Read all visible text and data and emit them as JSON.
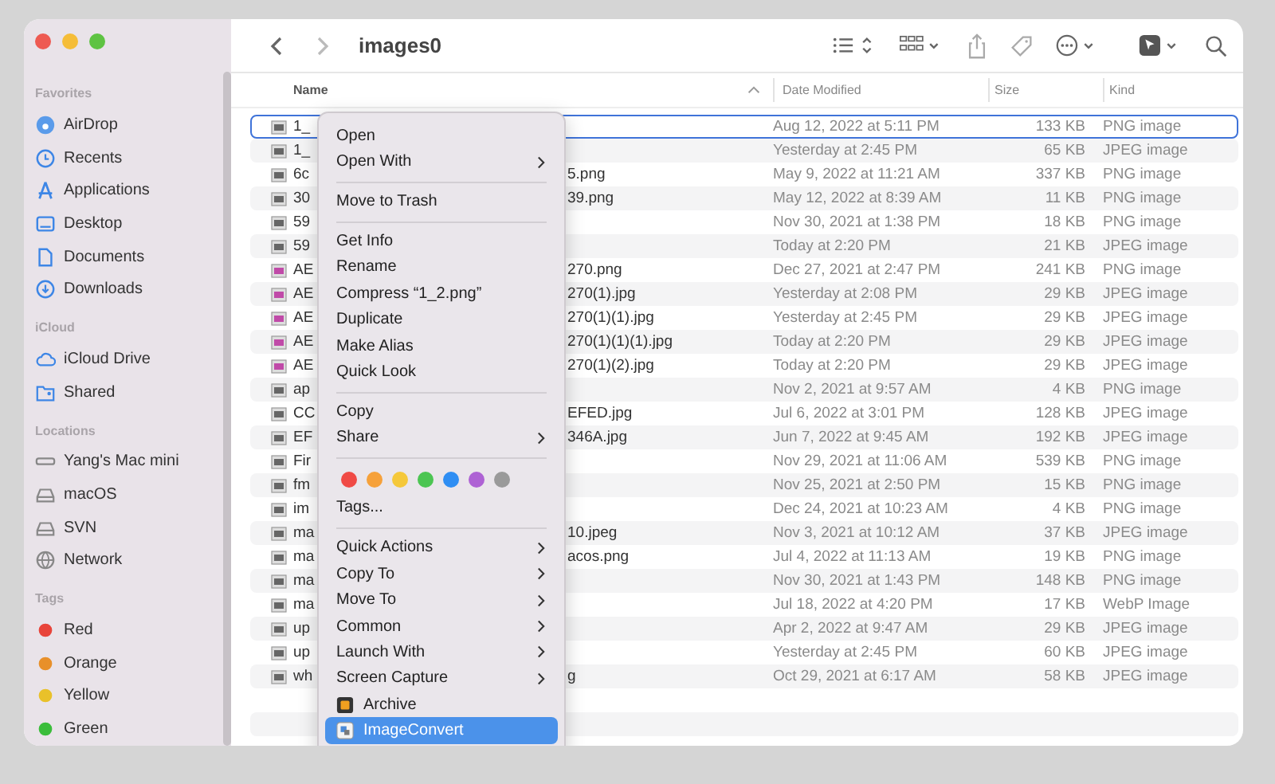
{
  "window": {
    "title": "images0"
  },
  "sidebar": {
    "sections": [
      {
        "heading": "Favorites",
        "items": [
          {
            "label": "AirDrop",
            "kind": "airdrop"
          },
          {
            "label": "Recents",
            "kind": "recents"
          },
          {
            "label": "Applications",
            "kind": "applications"
          },
          {
            "label": "Desktop",
            "kind": "desktop"
          },
          {
            "label": "Documents",
            "kind": "documents"
          },
          {
            "label": "Downloads",
            "kind": "downloads"
          }
        ]
      },
      {
        "heading": "iCloud",
        "items": [
          {
            "label": "iCloud Drive",
            "kind": "cloud"
          },
          {
            "label": "Shared",
            "kind": "shared"
          }
        ]
      },
      {
        "heading": "Locations",
        "items": [
          {
            "label": "Yang's Mac mini",
            "kind": "computer"
          },
          {
            "label": "macOS",
            "kind": "disk"
          },
          {
            "label": "SVN",
            "kind": "disk"
          },
          {
            "label": "Network",
            "kind": "network"
          }
        ]
      },
      {
        "heading": "Tags",
        "items": [
          {
            "label": "Red",
            "kind": "tag",
            "color": "#e8443a"
          },
          {
            "label": "Orange",
            "kind": "tag",
            "color": "#e8902a"
          },
          {
            "label": "Yellow",
            "kind": "tag",
            "color": "#e9c12a"
          },
          {
            "label": "Green",
            "kind": "tag",
            "color": "#3bbd3b"
          }
        ]
      }
    ]
  },
  "table": {
    "columns": [
      {
        "label": "Name",
        "sorted": true
      },
      {
        "label": "Date Modified",
        "sorted": false
      },
      {
        "label": "Size",
        "sorted": false
      },
      {
        "label": "Kind",
        "sorted": false
      }
    ],
    "rows": [
      {
        "name_start": "1_",
        "date": "Aug 12, 2022 at 5:11 PM",
        "size": "133 KB",
        "kind": "PNG image",
        "selected": true
      },
      {
        "name_start": "1_",
        "date": "Yesterday at 2:45 PM",
        "size": "65 KB",
        "kind": "JPEG image",
        "selected": false
      },
      {
        "name_start": "6c",
        "name_end": "5.png",
        "date": "May 9, 2022 at 11:21 AM",
        "size": "337 KB",
        "kind": "PNG image",
        "selected": false
      },
      {
        "name_start": "30",
        "name_end": "39.png",
        "date": "May 12, 2022 at 8:39 AM",
        "size": "11 KB",
        "kind": "PNG image",
        "selected": false
      },
      {
        "name_start": "59",
        "date": "Nov 30, 2021 at 1:38 PM",
        "size": "18 KB",
        "kind": "PNG image",
        "selected": false
      },
      {
        "name_start": "59",
        "date": "Today at 2:20 PM",
        "size": "21 KB",
        "kind": "JPEG image",
        "selected": false
      },
      {
        "name_start": "AE",
        "name_end": "270.png",
        "date": "Dec 27, 2021 at 2:47 PM",
        "size": "241 KB",
        "kind": "PNG image",
        "selected": false
      },
      {
        "name_start": "AE",
        "name_end": "270(1).jpg",
        "date": "Yesterday at 2:08 PM",
        "size": "29 KB",
        "kind": "JPEG image",
        "selected": false
      },
      {
        "name_start": "AE",
        "name_end": "270(1)(1).jpg",
        "date": "Yesterday at 2:45 PM",
        "size": "29 KB",
        "kind": "JPEG image",
        "selected": false
      },
      {
        "name_start": "AE",
        "name_end": "270(1)(1)(1).jpg",
        "date": "Today at 2:20 PM",
        "size": "29 KB",
        "kind": "JPEG image",
        "selected": false
      },
      {
        "name_start": "AE",
        "name_end": "270(1)(2).jpg",
        "date": "Today at 2:20 PM",
        "size": "29 KB",
        "kind": "JPEG image",
        "selected": false
      },
      {
        "name_start": "ap",
        "date": "Nov 2, 2021 at 9:57 AM",
        "size": "4 KB",
        "kind": "PNG image",
        "selected": false
      },
      {
        "name_start": "CC",
        "name_end": "EFED.jpg",
        "date": "Jul 6, 2022 at 3:01 PM",
        "size": "128 KB",
        "kind": "JPEG image",
        "selected": false
      },
      {
        "name_start": "EF",
        "name_end": "346A.jpg",
        "date": "Jun 7, 2022 at 9:45 AM",
        "size": "192 KB",
        "kind": "JPEG image",
        "selected": false
      },
      {
        "name_start": "Fir",
        "date": "Nov 29, 2021 at 11:06 AM",
        "size": "539 KB",
        "kind": "PNG image",
        "selected": false
      },
      {
        "name_start": "fm",
        "date": "Nov 25, 2021 at 2:50 PM",
        "size": "15 KB",
        "kind": "PNG image",
        "selected": false
      },
      {
        "name_start": "im",
        "date": "Dec 24, 2021 at 10:23 AM",
        "size": "4 KB",
        "kind": "PNG image",
        "selected": false
      },
      {
        "name_start": "ma",
        "name_end": "10.jpeg",
        "date": "Nov 3, 2021 at 10:12 AM",
        "size": "37 KB",
        "kind": "JPEG image",
        "selected": false
      },
      {
        "name_start": "ma",
        "name_end": "acos.png",
        "date": "Jul 4, 2022 at 11:13 AM",
        "size": "19 KB",
        "kind": "PNG image",
        "selected": false
      },
      {
        "name_start": "ma",
        "date": "Nov 30, 2021 at 1:43 PM",
        "size": "148 KB",
        "kind": "PNG image",
        "selected": false
      },
      {
        "name_start": "ma",
        "date": "Jul 18, 2022 at 4:20 PM",
        "size": "17 KB",
        "kind": "WebP Image",
        "selected": false
      },
      {
        "name_start": "up",
        "date": "Apr 2, 2022 at 9:47 AM",
        "size": "29 KB",
        "kind": "JPEG image",
        "selected": false
      },
      {
        "name_start": "up",
        "date": "Yesterday at 2:45 PM",
        "size": "60 KB",
        "kind": "JPEG image",
        "selected": false
      },
      {
        "name_start": "wh",
        "name_end": "g",
        "date": "Oct 29, 2021 at 6:17 AM",
        "size": "58 KB",
        "kind": "JPEG image",
        "selected": false
      }
    ]
  },
  "context_menu": {
    "items": [
      {
        "kind": "item",
        "label": "Open",
        "submenu": false,
        "highlighted": false
      },
      {
        "kind": "item",
        "label": "Open With",
        "submenu": true,
        "highlighted": false
      },
      {
        "kind": "separator"
      },
      {
        "kind": "item",
        "label": "Move to Trash",
        "submenu": false,
        "highlighted": false
      },
      {
        "kind": "separator"
      },
      {
        "kind": "item",
        "label": "Get Info",
        "submenu": false,
        "highlighted": false
      },
      {
        "kind": "item",
        "label": "Rename",
        "submenu": false,
        "highlighted": false
      },
      {
        "kind": "item",
        "label": "Compress “1_2.png”",
        "submenu": false,
        "highlighted": false
      },
      {
        "kind": "item",
        "label": "Duplicate",
        "submenu": false,
        "highlighted": false
      },
      {
        "kind": "item",
        "label": "Make Alias",
        "submenu": false,
        "highlighted": false
      },
      {
        "kind": "item",
        "label": "Quick Look",
        "submenu": false,
        "highlighted": false
      },
      {
        "kind": "separator"
      },
      {
        "kind": "item",
        "label": "Copy",
        "submenu": false,
        "highlighted": false
      },
      {
        "kind": "item",
        "label": "Share",
        "submenu": true,
        "highlighted": false
      },
      {
        "kind": "separator"
      },
      {
        "kind": "colors",
        "colors": [
          {
            "color": "#f04a45"
          },
          {
            "color": "#f6a13a"
          },
          {
            "color": "#f5c83a"
          },
          {
            "color": "#4cc552"
          },
          {
            "color": "#2f8ef3"
          },
          {
            "color": "#ae62d4"
          },
          {
            "color": "#9a9a9a"
          }
        ]
      },
      {
        "kind": "item",
        "label": "Tags...",
        "submenu": false,
        "highlighted": false
      },
      {
        "kind": "separator"
      },
      {
        "kind": "item",
        "label": "Quick Actions",
        "submenu": true,
        "highlighted": false
      },
      {
        "kind": "item",
        "label": "Copy To",
        "submenu": true,
        "highlighted": false
      },
      {
        "kind": "item",
        "label": "Move To",
        "submenu": true,
        "highlighted": false
      },
      {
        "kind": "item",
        "label": "Common",
        "submenu": true,
        "highlighted": false
      },
      {
        "kind": "item",
        "label": "Launch With",
        "submenu": true,
        "highlighted": false
      },
      {
        "kind": "item",
        "label": "Screen Capture",
        "submenu": true,
        "highlighted": false
      },
      {
        "kind": "archive",
        "label": "Archive",
        "submenu": false,
        "highlighted": false
      },
      {
        "kind": "converter",
        "label": "ImageConvert",
        "submenu": false,
        "highlighted": true
      }
    ]
  }
}
